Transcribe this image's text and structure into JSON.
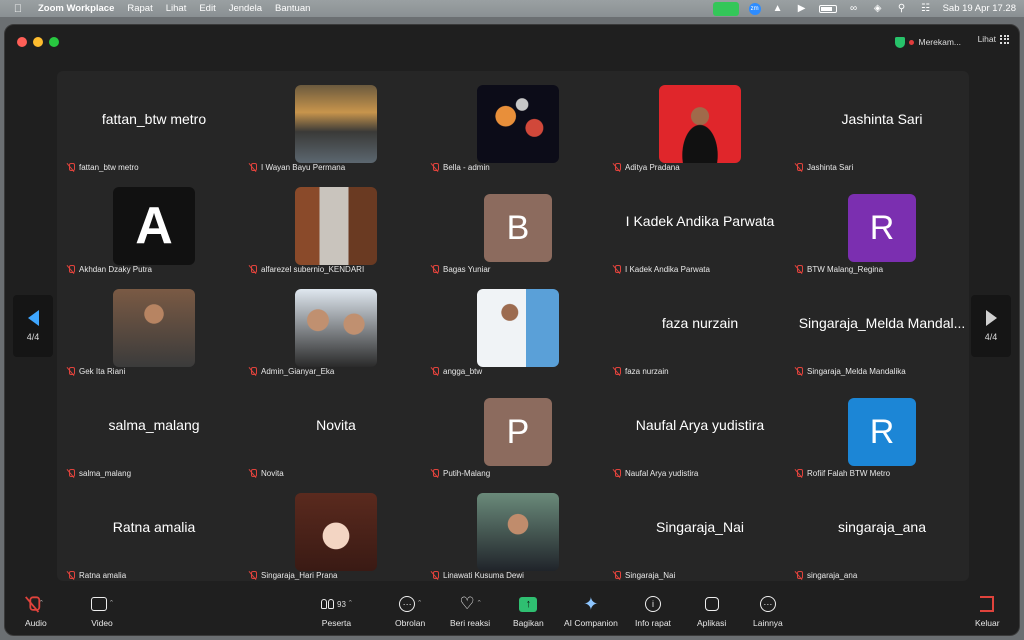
{
  "menubar": {
    "app_name": "Zoom Workplace",
    "menus": [
      "Rapat",
      "Lihat",
      "Edit",
      "Jendela",
      "Bantuan"
    ],
    "datetime": "Sab 19 Apr  17.28"
  },
  "titlebar": {
    "recording_label": "Merekam...",
    "view_label": "Lihat"
  },
  "pager": {
    "left_label": "4/4",
    "right_label": "4/4"
  },
  "tiles": [
    {
      "display": "text",
      "big": "fattan_btw metro",
      "label": "fattan_btw metro"
    },
    {
      "display": "photo",
      "photo": "sunset-person-photo",
      "label": "I Wayan Bayu Permana"
    },
    {
      "display": "photo",
      "photo": "planets-photo",
      "label": "Bella - admin"
    },
    {
      "display": "photo",
      "photo": "man-red-background-photo",
      "label": "Aditya Pradana"
    },
    {
      "display": "text",
      "big": "Jashinta Sari",
      "label": "Jashinta Sari"
    },
    {
      "display": "photo",
      "photo": "letter-a-logo-photo",
      "label": "Akhdan Dzaky Putra"
    },
    {
      "display": "photo",
      "photo": "man-suit-photo",
      "label": "alfarezel subernio_KENDARI"
    },
    {
      "display": "letter",
      "letter": "B",
      "color": "#8c6b5e",
      "label": "Bagas Yuniar"
    },
    {
      "display": "text",
      "big": "I Kadek Andika Parwata",
      "label": "I Kadek Andika Parwata"
    },
    {
      "display": "letter",
      "letter": "R",
      "color": "#7b2fb0",
      "label": "BTW Malang_Regina"
    },
    {
      "display": "photo",
      "photo": "woman-smiling-photo",
      "label": "Gek Ita Riani"
    },
    {
      "display": "photo",
      "photo": "two-women-photo",
      "label": "Admin_Gianyar_Eka"
    },
    {
      "display": "photo",
      "photo": "man-airport-photo",
      "label": "angga_btw"
    },
    {
      "display": "text",
      "big": "faza nurzain",
      "label": "faza nurzain"
    },
    {
      "display": "text",
      "big": "Singaraja_Melda Mandal...",
      "label": "Singaraja_Melda Mandalika"
    },
    {
      "display": "text",
      "big": "salma_malang",
      "label": "salma_malang"
    },
    {
      "display": "text",
      "big": "Novita",
      "label": "Novita"
    },
    {
      "display": "letter",
      "letter": "P",
      "color": "#8c6b5e",
      "label": "Putih-Malang"
    },
    {
      "display": "text",
      "big": "Naufal Arya yudistira",
      "label": "Naufal Arya yudistira"
    },
    {
      "display": "letter",
      "letter": "R",
      "color": "#1c86d6",
      "label": "Rofiif Falah BTW Metro"
    },
    {
      "display": "text",
      "big": "Ratna amalia",
      "label": "Ratna amalia"
    },
    {
      "display": "photo",
      "photo": "anime-character-photo",
      "label": "Singaraja_Hari Prana"
    },
    {
      "display": "photo",
      "photo": "woman-portrait-photo",
      "label": "Linawati Kusuma Dewi"
    },
    {
      "display": "text",
      "big": "Singaraja_Nai",
      "label": "Singaraja_Nai"
    },
    {
      "display": "text",
      "big": "singaraja_ana",
      "label": "singaraja_ana"
    }
  ],
  "toolbar": {
    "audio": "Audio",
    "video": "Video",
    "participants": "Peserta",
    "participants_count": "93",
    "chat": "Obrolan",
    "reactions": "Beri reaksi",
    "share": "Bagikan",
    "ai": "AI Companion",
    "info": "Info rapat",
    "apps": "Aplikasi",
    "more": "Lainnya",
    "leave": "Keluar"
  },
  "colors": {
    "accent_blue": "#3ea6ff",
    "share_green": "#2fbf71",
    "mute_red": "#e0433c"
  }
}
